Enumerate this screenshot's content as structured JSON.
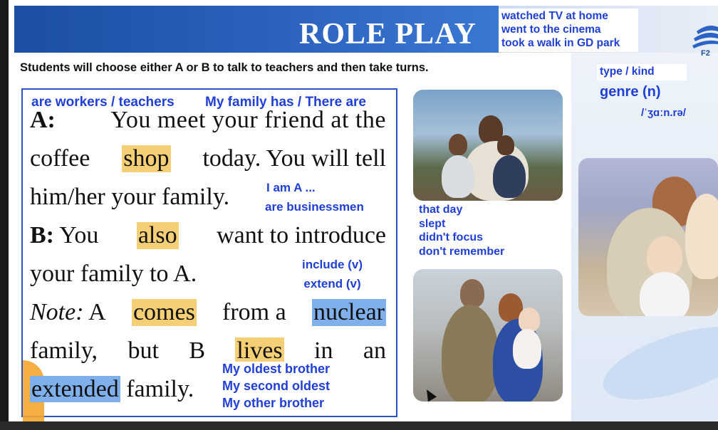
{
  "header": {
    "title": "ROLE PLAY",
    "notes": [
      "watched TV at home",
      "went to the cinema",
      "took a walk in GD park"
    ],
    "logo_text": "F2"
  },
  "instruction": "Students will choose either A or B to talk to teachers and then take turns.",
  "vocab": {
    "type_kind": "type / kind",
    "genre": "genre (n)",
    "ipa": "/ˈʒɑːn.rə/"
  },
  "box": {
    "notes_top_left": "are workers / teachers",
    "notes_top_right": "My family has / There are",
    "line1": {
      "a": "A:",
      "rest": "You meet your friend at the"
    },
    "line2": {
      "pre": "coffee",
      "hl": "shop",
      "post": "today. You will tell"
    },
    "line3": "him/her your family.",
    "notes_i_am": [
      "I am A ...",
      "are businessmen"
    ],
    "line4": {
      "b": "B:",
      "pre": "You",
      "hl": "also",
      "post": "want to introduce"
    },
    "line5": "your family to A.",
    "notes_verbs": [
      "include (v)",
      "extend (v)"
    ],
    "line6": {
      "note": "Note:",
      "a": "A",
      "hl1": "comes",
      "mid": "from a",
      "hl2": "nuclear"
    },
    "line7": {
      "w1": "family,",
      "w2": "but",
      "w3": "B",
      "hl": "lives",
      "w4": "in",
      "w5": "an"
    },
    "line8": {
      "hl": "extended",
      "post": "family."
    },
    "notes_brothers": [
      "My oldest brother",
      "My second oldest",
      "My other brother"
    ]
  },
  "photo_notes": [
    "that day",
    "slept",
    "didn't focus",
    "don't remember"
  ],
  "colors": {
    "note_text": "#1f3fd6",
    "highlight_yellow": "#f5cf76",
    "highlight_blue": "#7fb0ec",
    "header_blue": "#1c4fa3"
  }
}
